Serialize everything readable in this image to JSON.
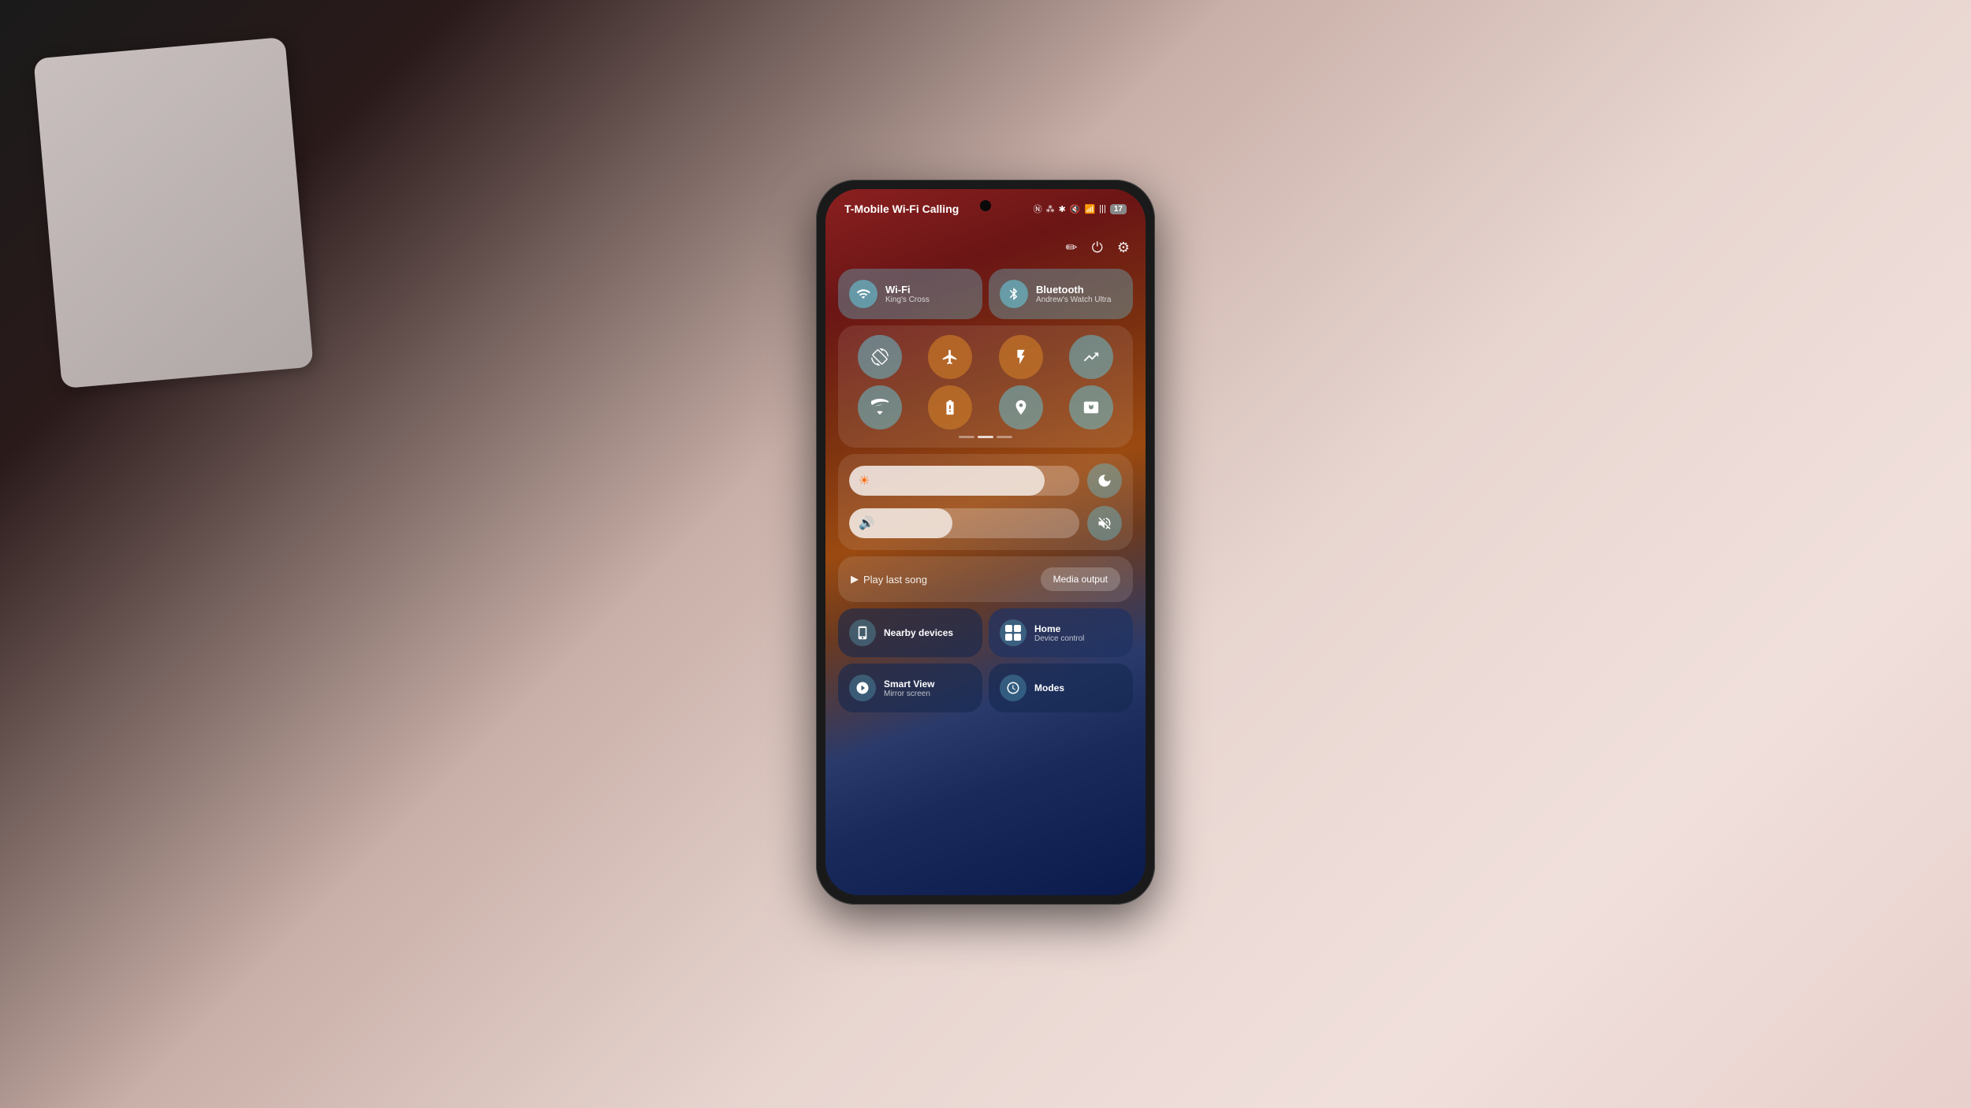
{
  "background": {
    "description": "Hand holding Samsung phone showing quick settings panel"
  },
  "status_bar": {
    "carrier": "T-Mobile Wi-Fi Calling",
    "icons": [
      "NFC",
      "data",
      "bluetooth",
      "mute",
      "signal",
      "bars",
      "battery"
    ],
    "battery_level": "17"
  },
  "header_icons": {
    "edit_label": "✏",
    "power_label": "⏻",
    "settings_label": "⚙"
  },
  "wifi_tile": {
    "title": "Wi-Fi",
    "subtitle": "King's Cross",
    "active": true
  },
  "bluetooth_tile": {
    "title": "Bluetooth",
    "subtitle": "Andrew's Watch Ultra",
    "active": true
  },
  "grid_tiles": {
    "row1": [
      {
        "name": "auto-rotate",
        "color": "teal"
      },
      {
        "name": "airplane-mode",
        "color": "orange"
      },
      {
        "name": "flashlight",
        "color": "orange"
      },
      {
        "name": "data-saver",
        "color": "teal"
      }
    ],
    "row2": [
      {
        "name": "rss-feed",
        "color": "teal"
      },
      {
        "name": "battery-saver",
        "color": "orange"
      },
      {
        "name": "location",
        "color": "teal"
      },
      {
        "name": "screen-record",
        "color": "teal"
      }
    ]
  },
  "brightness_slider": {
    "icon": "☀",
    "fill_percent": 85,
    "end_icon": "moon"
  },
  "volume_slider": {
    "icon": "🔊",
    "fill_percent": 45,
    "end_icon": "mute"
  },
  "media_bar": {
    "play_text": "Play last song",
    "output_button": "Media output"
  },
  "nearby_tile": {
    "title": "Nearby devices",
    "subtitle": ""
  },
  "home_tile": {
    "title": "Home",
    "subtitle": "Device control"
  },
  "smart_view_tile": {
    "title": "Smart View",
    "subtitle": "Mirror screen"
  },
  "modes_tile": {
    "title": "Modes",
    "subtitle": ""
  }
}
